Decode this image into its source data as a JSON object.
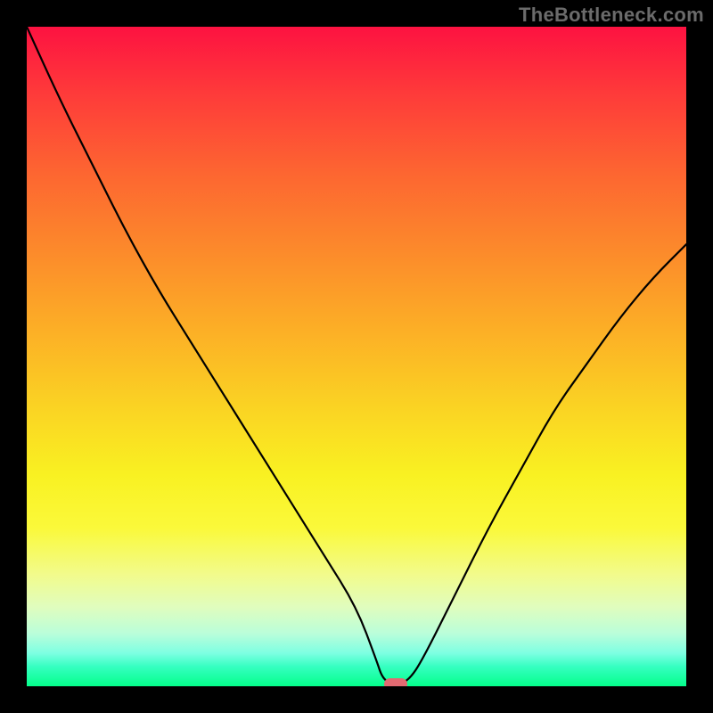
{
  "watermark": "TheBottleneck.com",
  "chart_data": {
    "type": "line",
    "title": "",
    "xlabel": "",
    "ylabel": "",
    "xlim": [
      0,
      100
    ],
    "ylim": [
      0,
      100
    ],
    "series": [
      {
        "name": "curve",
        "x": [
          0,
          5,
          10,
          15,
          20,
          25,
          30,
          35,
          40,
          45,
          50,
          53,
          54,
          56,
          58,
          60,
          65,
          70,
          75,
          80,
          85,
          90,
          95,
          100
        ],
        "values": [
          100,
          89,
          79,
          69,
          60,
          52,
          44,
          36,
          28,
          20,
          12,
          4,
          1,
          0,
          1,
          4,
          14,
          24,
          33,
          42,
          49,
          56,
          62,
          67
        ]
      }
    ],
    "marker": {
      "x": 56,
      "y": 0
    },
    "gradient_stops": [
      {
        "pct": 0,
        "color": "#fd1241"
      },
      {
        "pct": 25,
        "color": "#fc8a2b"
      },
      {
        "pct": 60,
        "color": "#fad423"
      },
      {
        "pct": 80,
        "color": "#f7fb5a"
      },
      {
        "pct": 95,
        "color": "#7dffe2"
      },
      {
        "pct": 100,
        "color": "#04ff8b"
      }
    ]
  }
}
